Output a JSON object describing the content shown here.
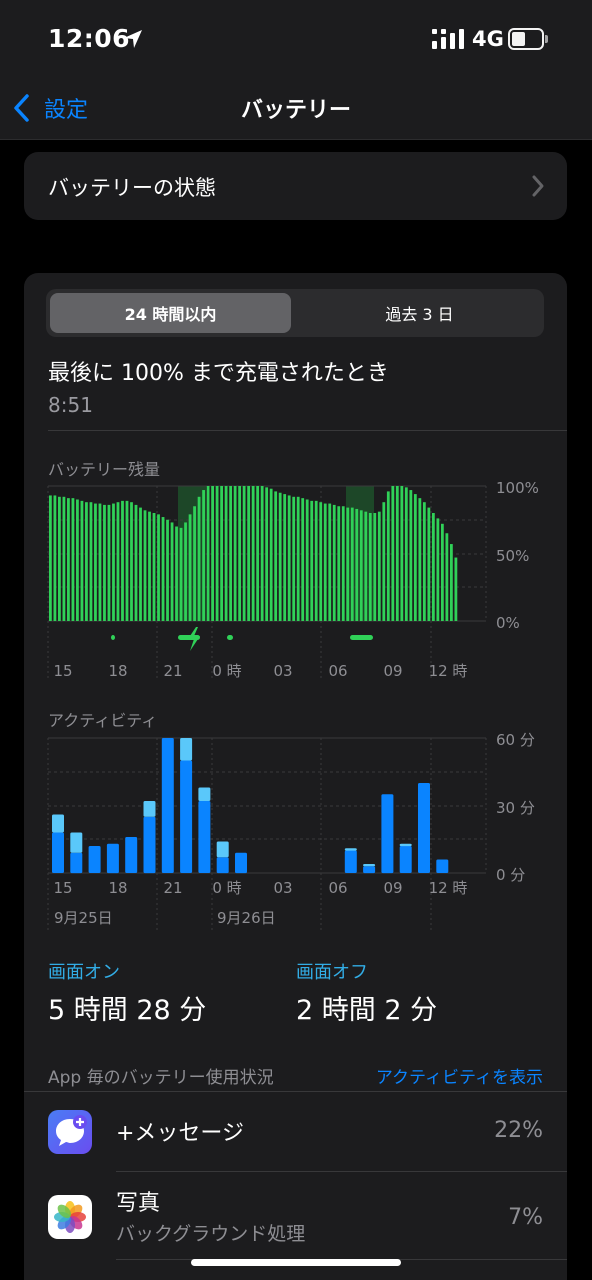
{
  "status": {
    "time": "12:06",
    "network": "4G"
  },
  "nav": {
    "back_label": "設定",
    "title": "バッテリー"
  },
  "health": {
    "label": "バッテリーの状態"
  },
  "segment": {
    "active": "24 時間以内",
    "inactive": "過去 3 日"
  },
  "last_charge": {
    "label": "最後に 100% まで充電されたとき",
    "time": "8:51"
  },
  "battery_chart": {
    "title": "バッテリー残量",
    "y_labels": [
      "100%",
      "50%",
      "0%"
    ],
    "x_labels": [
      "15",
      "18",
      "21",
      "0 時",
      "03",
      "06",
      "09",
      "12 時"
    ]
  },
  "activity_chart": {
    "title": "アクティビティ",
    "y_labels": [
      "60 分",
      "30 分",
      "0 分"
    ],
    "x_labels": [
      "15",
      "18",
      "21",
      "0 時",
      "03",
      "06",
      "09",
      "12 時"
    ],
    "date_labels": [
      "9月25日",
      "9月26日"
    ]
  },
  "usage": {
    "screen_on_label": "画面オン",
    "screen_on_value": "5 時間 28 分",
    "screen_off_label": "画面オフ",
    "screen_off_value": "2 時間 2 分"
  },
  "apps": {
    "header": "App 毎のバッテリー使用状況",
    "link": "アクティビティを表示",
    "items": [
      {
        "name": "+メッセージ",
        "sub": "",
        "percent": "22%"
      },
      {
        "name": "写真",
        "sub": "バックグラウンド処理",
        "percent": "7%"
      }
    ]
  },
  "chart_data": [
    {
      "type": "bar",
      "title": "バッテリー残量",
      "x_ticks": [
        "15",
        "18",
        "21",
        "0 時",
        "03",
        "06",
        "09",
        "12 時"
      ],
      "y_ticks": [
        "0%",
        "50%",
        "100%"
      ],
      "ylim": [
        0,
        100
      ],
      "series": [
        {
          "values": [
            93,
            93,
            92,
            92,
            91,
            91,
            90,
            89,
            88,
            88,
            87,
            87,
            86,
            86,
            87,
            88,
            89,
            89,
            88,
            86,
            84,
            82,
            81,
            80,
            79,
            77,
            75,
            73,
            70,
            69,
            73,
            79,
            85,
            92,
            97,
            100,
            100,
            100,
            100,
            100,
            100,
            100,
            100,
            100,
            100,
            100,
            100,
            100,
            99,
            98,
            96,
            95,
            94,
            93,
            92,
            92,
            91,
            90,
            89,
            89,
            88,
            87,
            87,
            86,
            85,
            85,
            84,
            84,
            83,
            82,
            81,
            80,
            80,
            81,
            88,
            96,
            100,
            100,
            100,
            99,
            97,
            94,
            91,
            88,
            84,
            80,
            76,
            72,
            65,
            57,
            47
          ]
        }
      ],
      "charging_windows": [
        "18",
        "21–23",
        "0",
        "07–08"
      ]
    },
    {
      "type": "bar",
      "title": "アクティビティ",
      "x_ticks": [
        "15",
        "18",
        "21",
        "0 時",
        "03",
        "06",
        "09",
        "12 時"
      ],
      "y_ticks": [
        "0 分",
        "30 分",
        "60 分"
      ],
      "ylim": [
        0,
        60
      ],
      "categories": [
        "14",
        "15",
        "16",
        "17",
        "18",
        "19",
        "20",
        "21",
        "22",
        "23",
        "0",
        "1",
        "2",
        "3",
        "4",
        "5",
        "6",
        "7",
        "8",
        "9",
        "10",
        "11"
      ],
      "series": [
        {
          "name": "画面オン",
          "values": [
            18,
            9,
            12,
            13,
            16,
            25,
            60,
            50,
            32,
            7,
            9,
            0,
            0,
            0,
            0,
            0,
            10,
            3,
            35,
            12,
            40,
            6
          ]
        },
        {
          "name": "画面オフ",
          "values": [
            8,
            9,
            0,
            0,
            0,
            7,
            0,
            10,
            6,
            7,
            0,
            0,
            0,
            0,
            0,
            0,
            1,
            1,
            0,
            1,
            0,
            0
          ]
        }
      ]
    }
  ]
}
